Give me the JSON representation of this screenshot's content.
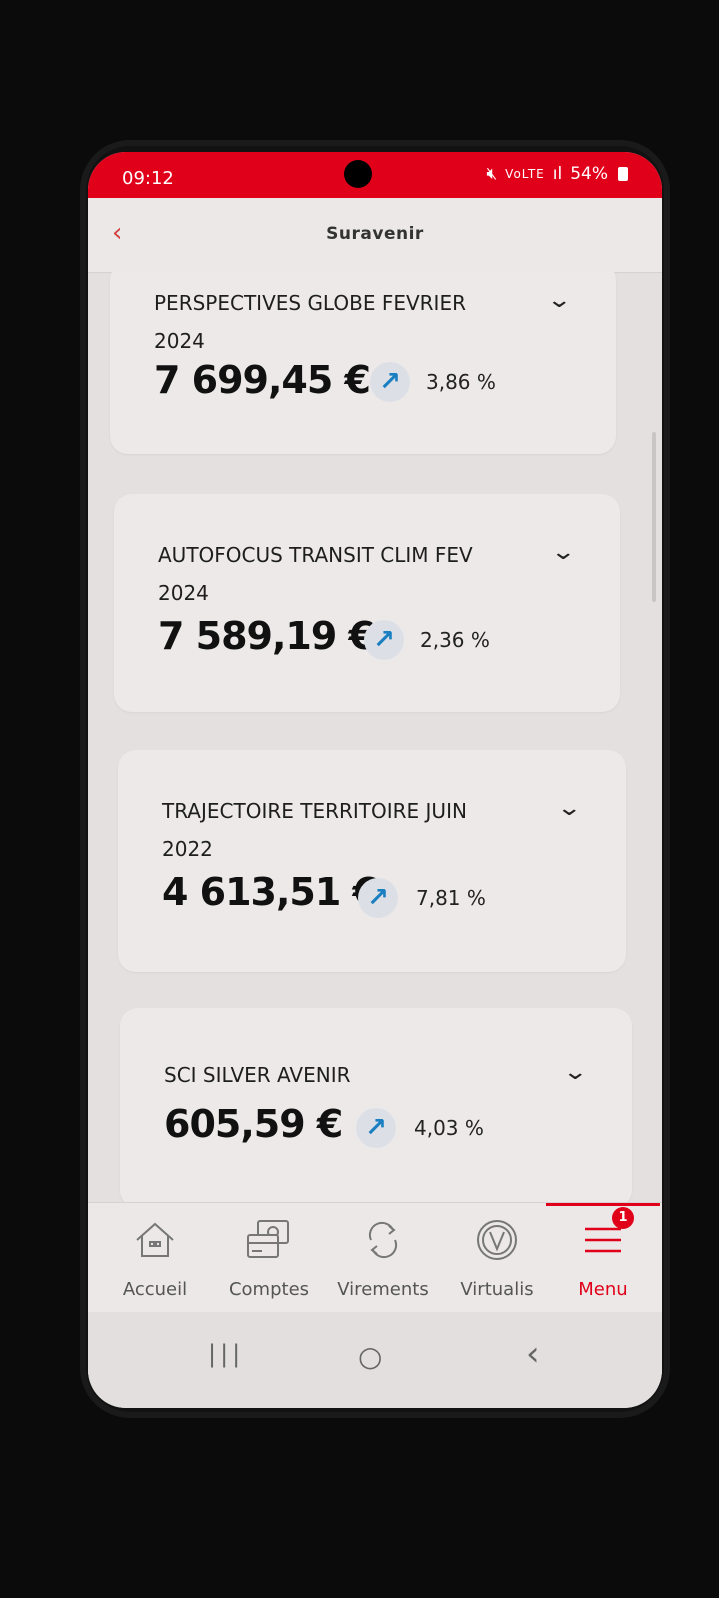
{
  "status": {
    "time": "09:12",
    "signal": "ᯤ ⫶ ıl",
    "volte": "VoLTE",
    "battery": "54%"
  },
  "header": {
    "back_label": "‹",
    "title": "Suravenir"
  },
  "products": [
    {
      "name_line1": "PERSPECTIVES GLOBE FEVRIER",
      "name_line2": "2024",
      "amount": "7 699,45 €",
      "trend": "↗",
      "performance": "3,86 %"
    },
    {
      "name_line1": "AUTOFOCUS TRANSIT CLIM FEV",
      "name_line2": "2024",
      "amount": "7 589,19 €",
      "trend": "↗",
      "performance": "2,36 %"
    },
    {
      "name_line1": "TRAJECTOIRE TERRITOIRE JUIN",
      "name_line2": "2022",
      "amount": "4 613,51 €",
      "trend": "↗",
      "performance": "7,81 %"
    },
    {
      "name_line1": "SCI SILVER AVENIR",
      "amount": "605,59 €",
      "trend": "↗",
      "performance": "4,03 %"
    }
  ],
  "tabs": [
    {
      "label": "Accueil",
      "icon": "home-icon"
    },
    {
      "label": "Comptes",
      "icon": "cards-icon"
    },
    {
      "label": "Virements",
      "icon": "transfer-icon"
    },
    {
      "label": "Virtualis",
      "icon": "virtualis-icon"
    },
    {
      "label": "Menu",
      "icon": "menu-icon",
      "badge": "1",
      "active": true
    }
  ],
  "navigation": {
    "recents": "|||",
    "home": "○",
    "back": "‹"
  },
  "colors": {
    "brand": "#e1001a",
    "trend": "#1a7fc1"
  }
}
